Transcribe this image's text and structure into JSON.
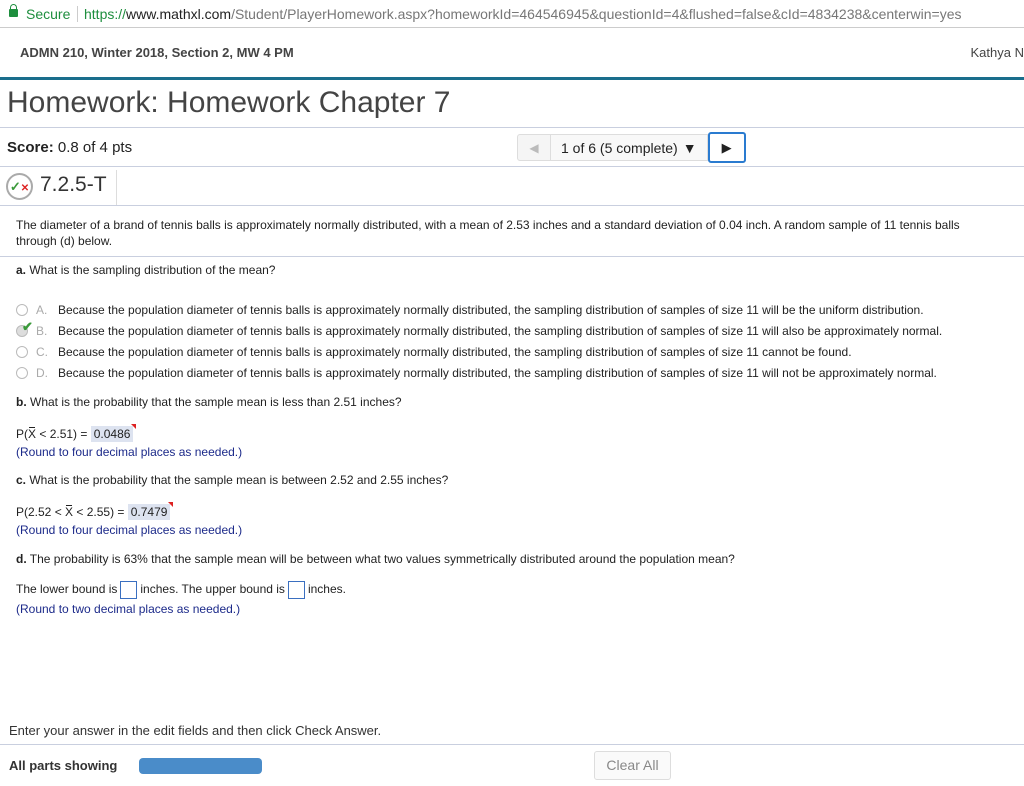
{
  "browser": {
    "secure_label": "Secure",
    "url_scheme": "https://",
    "url_domain": "www.mathxl.com",
    "url_path": "/Student/PlayerHomework.aspx?homeworkId=464546945&questionId=4&flushed=false&cId=4834238&centerwin=yes"
  },
  "header": {
    "course": "ADMN 210, Winter 2018, Section 2, MW 4 PM",
    "user": "Kathya N"
  },
  "page": {
    "title": "Homework: Homework Chapter 7",
    "score_label": "Score:",
    "score_value": "0.8 of 4 pts"
  },
  "nav": {
    "question_select": "1 of 6 (5 complete)",
    "prev": "◀",
    "next": "▶"
  },
  "question": {
    "id": "7.2.5-T",
    "stem_line1": "The diameter of a brand of tennis balls is approximately normally distributed, with a mean of 2.53 inches and a standard deviation of 0.04 inch. A random sample of 11 tennis balls",
    "stem_line2": "through (d) below.",
    "a_label": "a.",
    "a_text": " What is the sampling distribution of the mean?",
    "options": [
      {
        "letter": "A.",
        "text": "Because the population diameter of tennis balls is approximately normally distributed, the sampling distribution of samples of size 11 will be the uniform distribution.",
        "selected": false
      },
      {
        "letter": "B.",
        "text": "Because the population diameter of tennis balls is approximately normally distributed, the sampling distribution of samples of size 11 will also be approximately normal.",
        "selected": true
      },
      {
        "letter": "C.",
        "text": "Because the population diameter of tennis balls is approximately normally distributed, the sampling distribution of samples of size 11 cannot be found.",
        "selected": false
      },
      {
        "letter": "D.",
        "text": "Because the population diameter of tennis balls is approximately normally distributed, the sampling distribution of samples of size 11 will not be approximately normal.",
        "selected": false
      }
    ],
    "b_label": "b.",
    "b_text": " What is the probability that the sample mean is less than 2.51 inches?",
    "b_expr_pre": "P(",
    "b_expr_var": "X",
    "b_expr_post": " < 2.51) = ",
    "b_answer": "0.0486",
    "b_hint": "(Round to four decimal places as needed.)",
    "c_label": "c.",
    "c_text": " What is the probability that the sample mean is between 2.52 and 2.55 inches?",
    "c_expr_pre": "P(2.52 < ",
    "c_expr_var": "X",
    "c_expr_post": " < 2.55) = ",
    "c_answer": "0.7479",
    "c_hint": "(Round to four decimal places as needed.)",
    "d_label": "d.",
    "d_text": " The probability is 63% that the sample mean will be between what two values symmetrically distributed around the population mean?",
    "d_lower_pre": "The lower bound is",
    "d_mid": "inches. The upper bound is",
    "d_post": "inches.",
    "d_hint": "(Round to two decimal places as needed.)"
  },
  "footer": {
    "instruction": "Enter your answer in the edit fields and then click Check Answer.",
    "parts_label": "All parts showing",
    "clear_all": "Clear All"
  }
}
